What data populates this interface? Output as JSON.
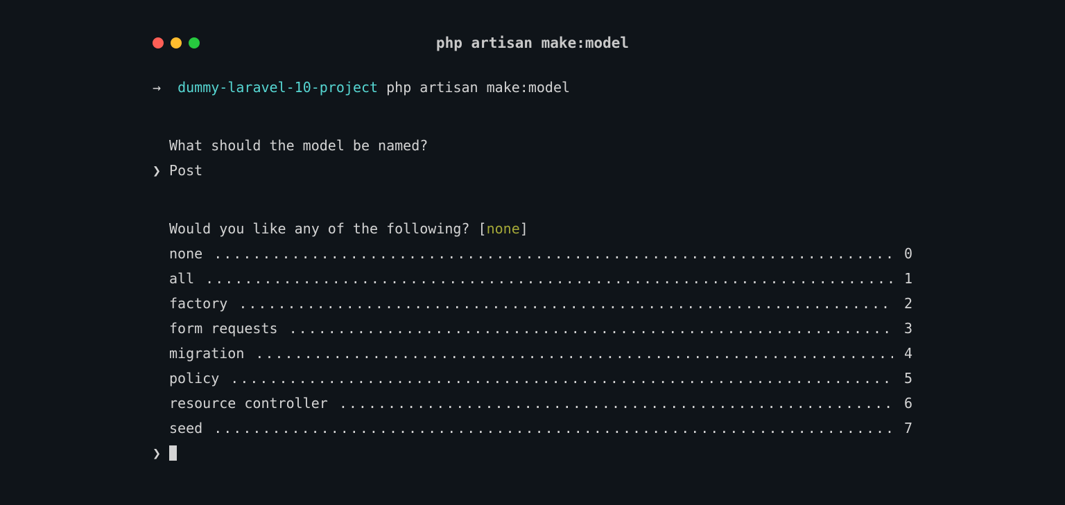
{
  "window": {
    "title": "php artisan make:model"
  },
  "prompt": {
    "arrow": "→",
    "project": "dummy-laravel-10-project",
    "command": "php artisan make:model"
  },
  "question1": {
    "text": "What should the model be named?",
    "caret": "❯",
    "answer": "Post"
  },
  "question2": {
    "text": "Would you like any of the following?",
    "default": "none",
    "caret": "❯",
    "options": [
      {
        "label": "none",
        "num": "0"
      },
      {
        "label": "all",
        "num": "1"
      },
      {
        "label": "factory",
        "num": "2"
      },
      {
        "label": "form requests",
        "num": "3"
      },
      {
        "label": "migration",
        "num": "4"
      },
      {
        "label": "policy",
        "num": "5"
      },
      {
        "label": "resource controller",
        "num": "6"
      },
      {
        "label": "seed",
        "num": "7"
      }
    ]
  }
}
